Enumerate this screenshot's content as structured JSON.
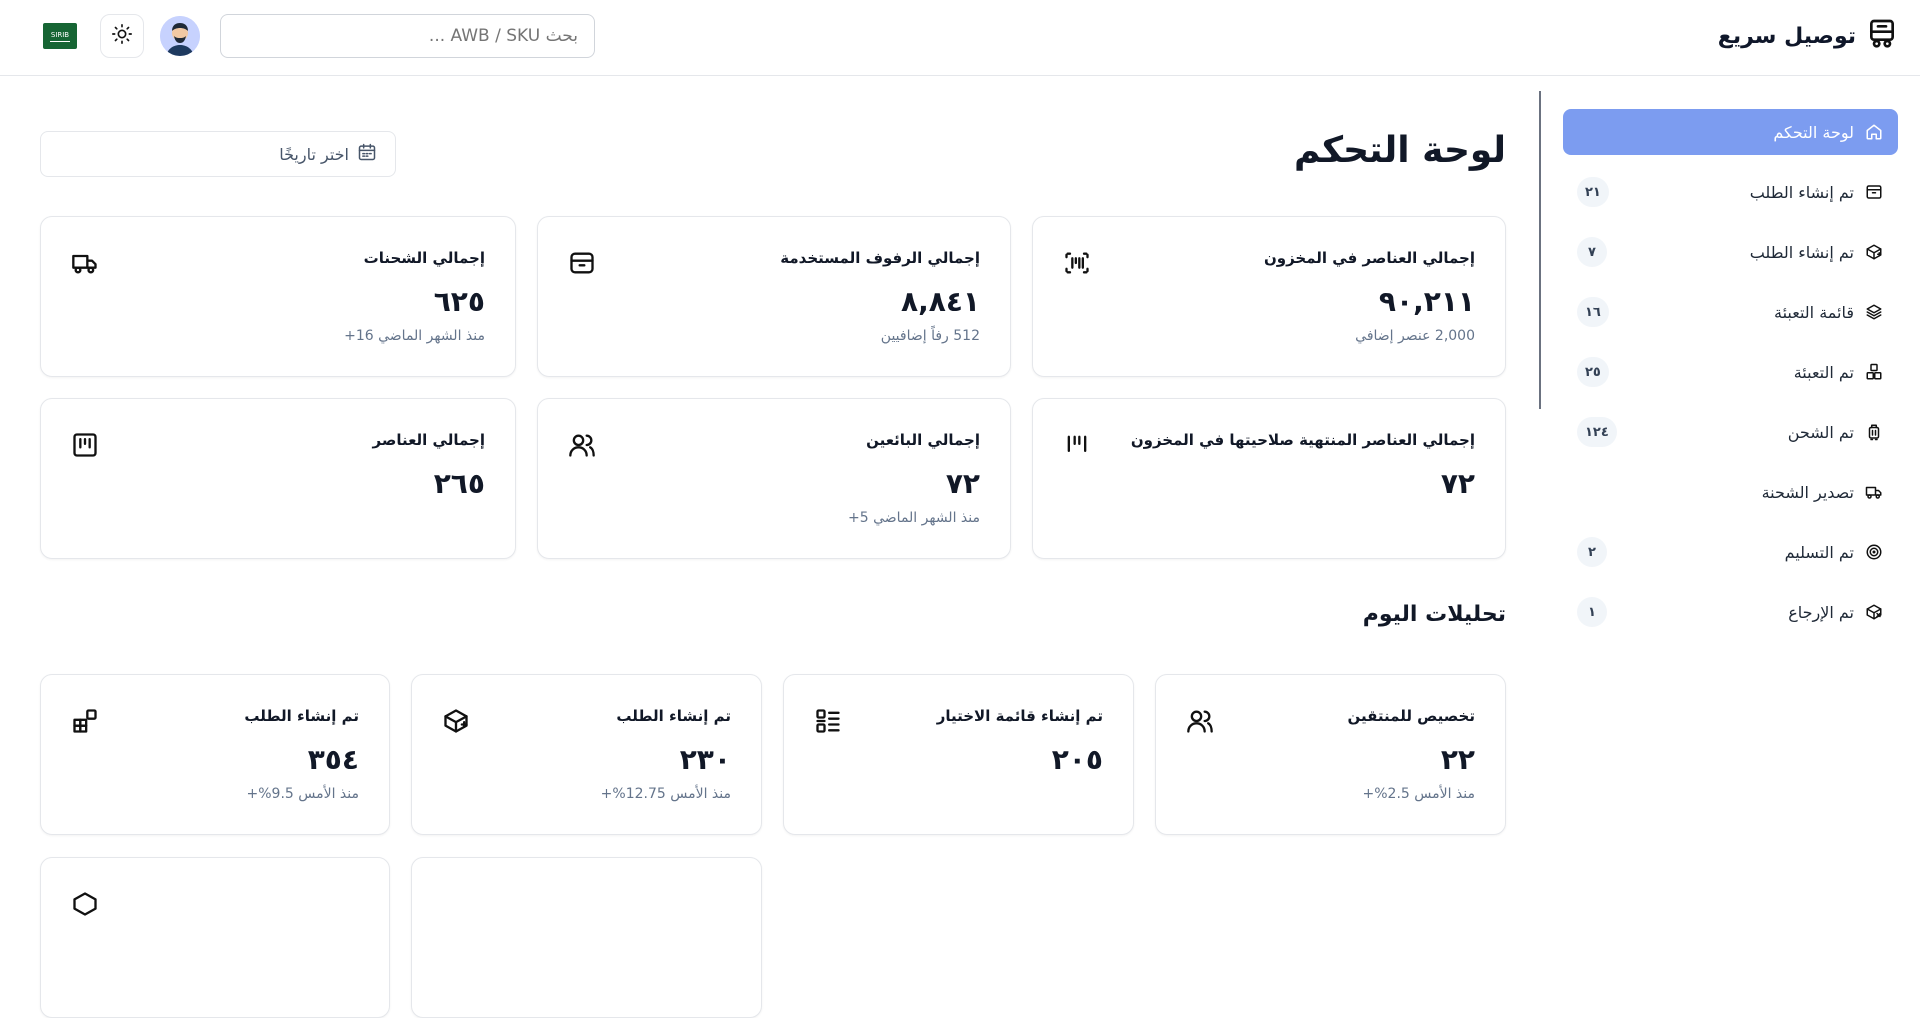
{
  "header": {
    "brand_name": "توصيل سريع",
    "search_placeholder": "بحث AWB / SKU ...",
    "flag_text": "SIRIB"
  },
  "sidebar": {
    "items": [
      {
        "label": "لوحة التحكم",
        "badge": "",
        "icon": "home-icon",
        "active": true
      },
      {
        "label": "تم إنشاء الطلب",
        "badge": "٢١",
        "icon": "box-icon"
      },
      {
        "label": "تم إنشاء الطلب",
        "badge": "٧",
        "icon": "package-plus-icon"
      },
      {
        "label": "قائمة التعبئة",
        "badge": "١٦",
        "icon": "layers-box-icon"
      },
      {
        "label": "تم التعبئة",
        "badge": "٢٥",
        "icon": "boxes-icon"
      },
      {
        "label": "تم الشحن",
        "badge": "١٢٤",
        "icon": "luggage-icon"
      },
      {
        "label": "تصدير الشحنة",
        "badge": "",
        "icon": "truck-icon"
      },
      {
        "label": "تم التسليم",
        "badge": "٢",
        "icon": "target-icon"
      },
      {
        "label": "تم الإرجاع",
        "badge": "١",
        "icon": "package-x-icon"
      }
    ]
  },
  "main": {
    "title": "لوحة التحكم",
    "date_placeholder": "اختر تاريخًا",
    "stats": [
      {
        "title": "إجمالي العناصر في المخزون",
        "value": "٩٠,٢١١",
        "sub": "2,000 عنصر إضافي",
        "icon": "scan-barcode-icon"
      },
      {
        "title": "إجمالي الرفوف المستخدمة",
        "value": "٨,٨٤١",
        "sub": "512 رفاً إضافيين",
        "icon": "archive-box-icon"
      },
      {
        "title": "إجمالي الشحنات",
        "value": "٦٢٥",
        "sub": "منذ الشهر الماضي 16+",
        "icon": "truck-icon"
      },
      {
        "title": "إجمالي العناصر المنتهية صلاحيتها في المخزون",
        "value": "٧٢",
        "sub": "",
        "icon": "barcode-icon"
      },
      {
        "title": "إجمالي البائعين",
        "value": "٧٢",
        "sub": "منذ الشهر الماضي 5+",
        "icon": "users-icon"
      },
      {
        "title": "إجمالي العناصر",
        "value": "٢٦٥",
        "sub": "",
        "icon": "barcode-box-icon"
      }
    ],
    "analytics_title": "تحليلات اليوم",
    "analytics": [
      {
        "title": "تخصيص للمنتقين",
        "value": "٢٢",
        "sub": "منذ الأمس 2.5%+",
        "icon": "users-icon"
      },
      {
        "title": "تم إنشاء قائمة الاختيار",
        "value": "٢٠٥",
        "sub": "",
        "icon": "list-checks-icon"
      },
      {
        "title": "تم إنشاء الطلب",
        "value": "٢٣٠",
        "sub": "منذ الأمس 12.75%+",
        "icon": "package-plus-icon"
      },
      {
        "title": "تم إنشاء الطلب",
        "value": "٣٥٤",
        "sub": "منذ الأمس 9.5%+",
        "icon": "blocks-icon"
      }
    ]
  }
}
